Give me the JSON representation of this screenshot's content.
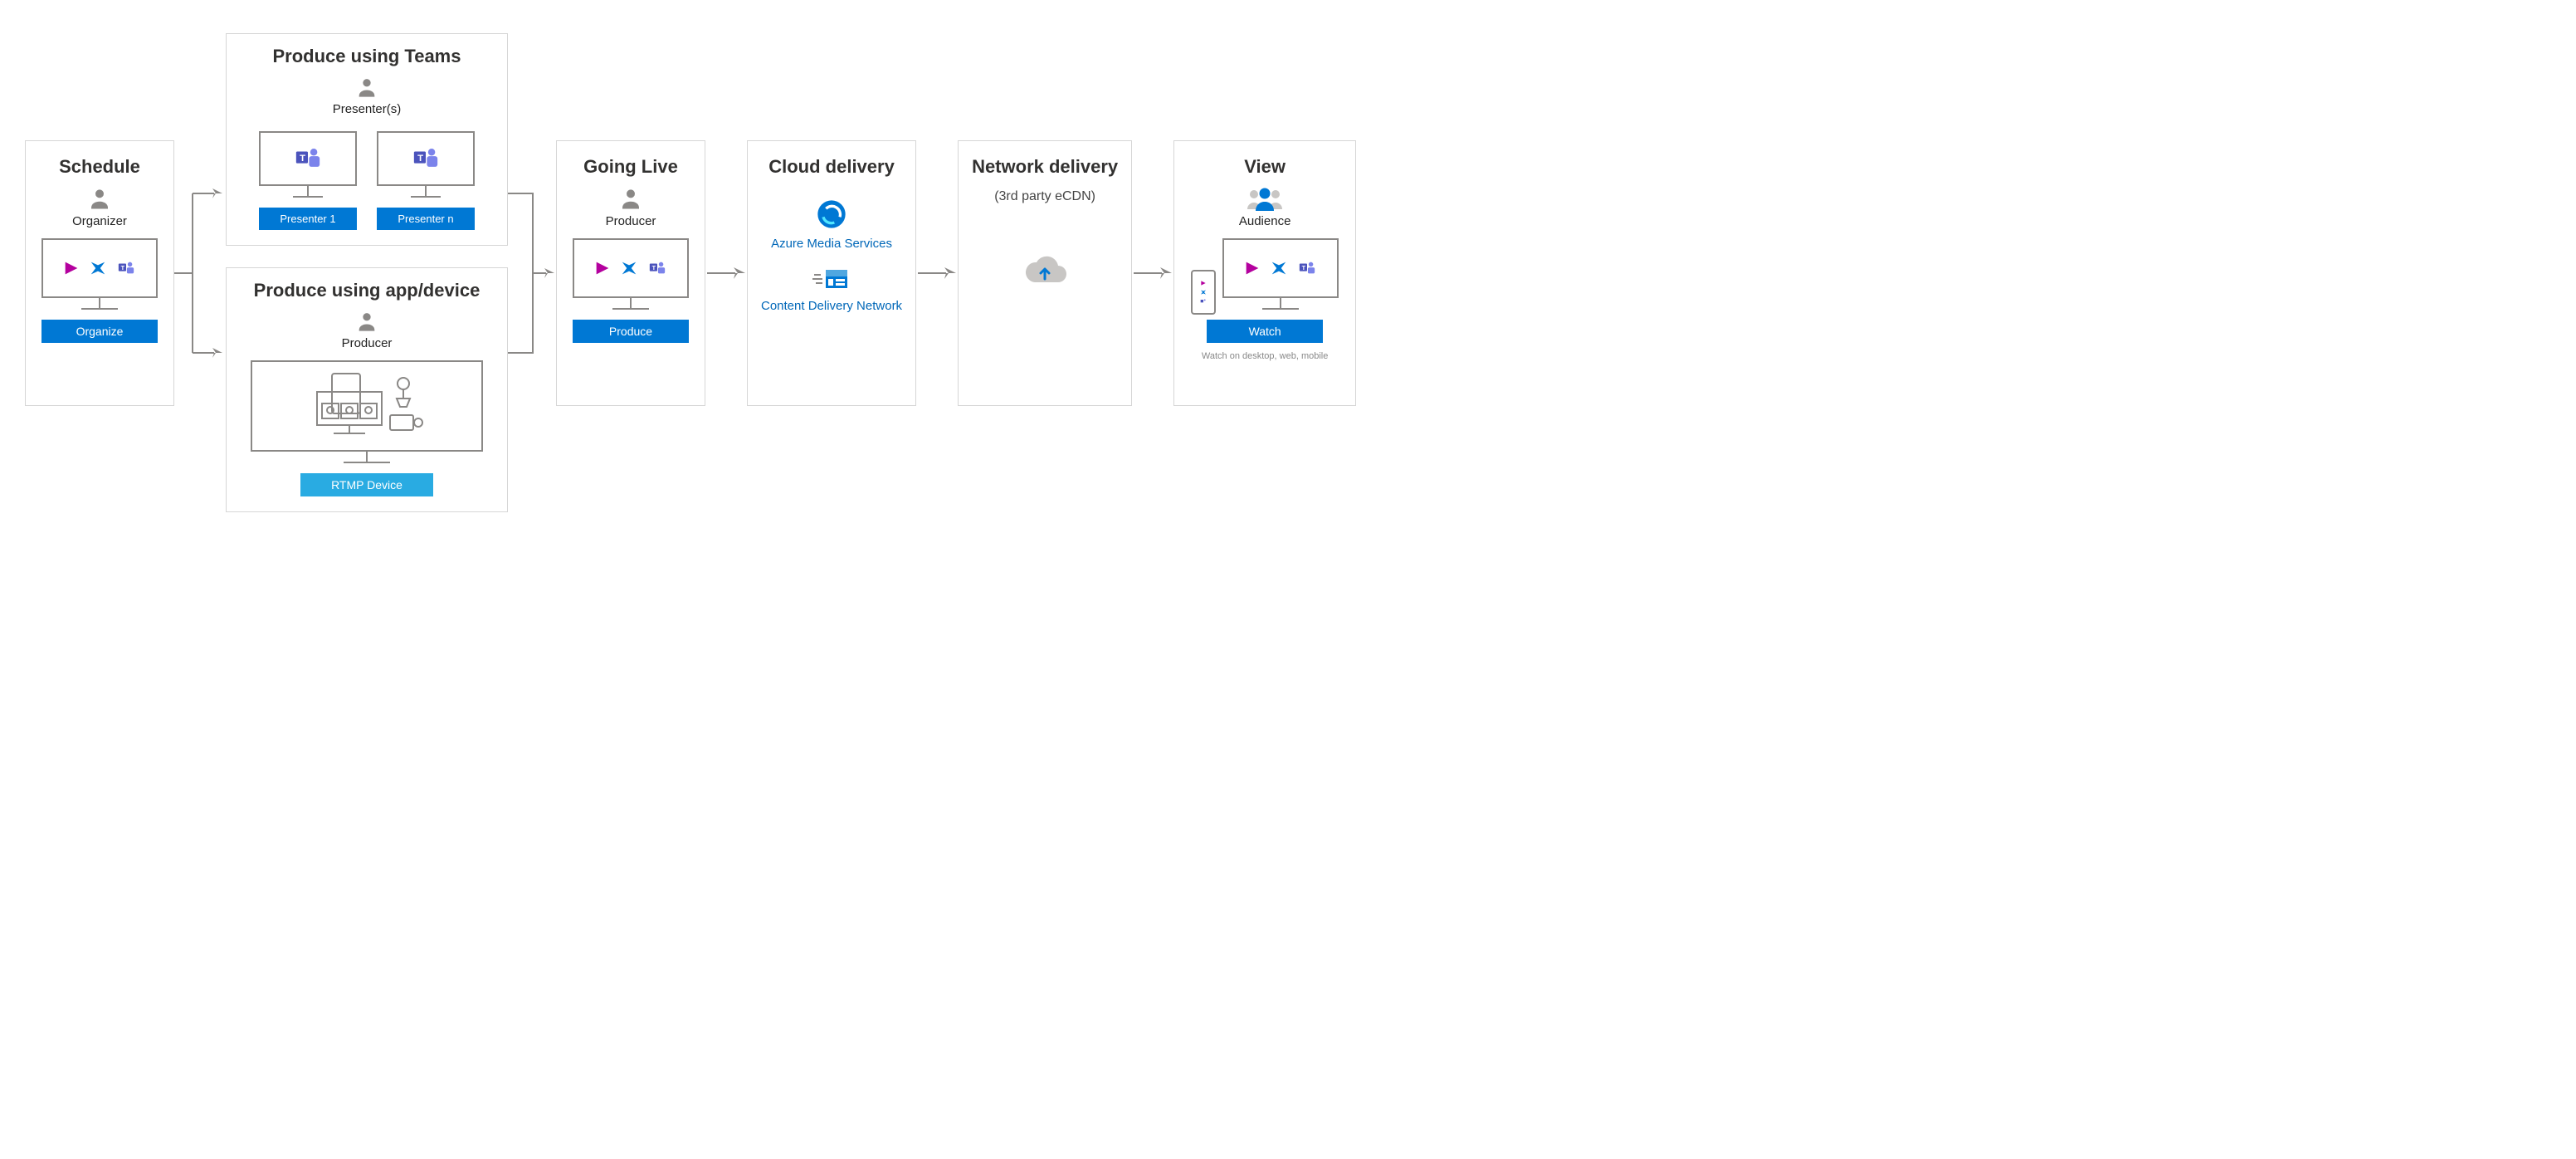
{
  "schedule": {
    "title": "Schedule",
    "role": "Organizer",
    "btn": "Organize"
  },
  "produce_teams": {
    "title": "Produce using Teams",
    "role": "Presenter(s)",
    "p1": "Presenter 1",
    "p2": "Presenter n"
  },
  "produce_app": {
    "title": "Produce using app/device",
    "role": "Producer",
    "btn": "RTMP Device"
  },
  "golive": {
    "title": "Going Live",
    "role": "Producer",
    "btn": "Produce"
  },
  "cloud": {
    "title": "Cloud delivery",
    "link1": "Azure Media Services",
    "link2": "Content Delivery Network"
  },
  "network": {
    "title": "Network delivery",
    "sub": "(3rd party eCDN)"
  },
  "view": {
    "title": "View",
    "role": "Audience",
    "btn": "Watch",
    "note": "Watch on desktop, web, mobile"
  }
}
